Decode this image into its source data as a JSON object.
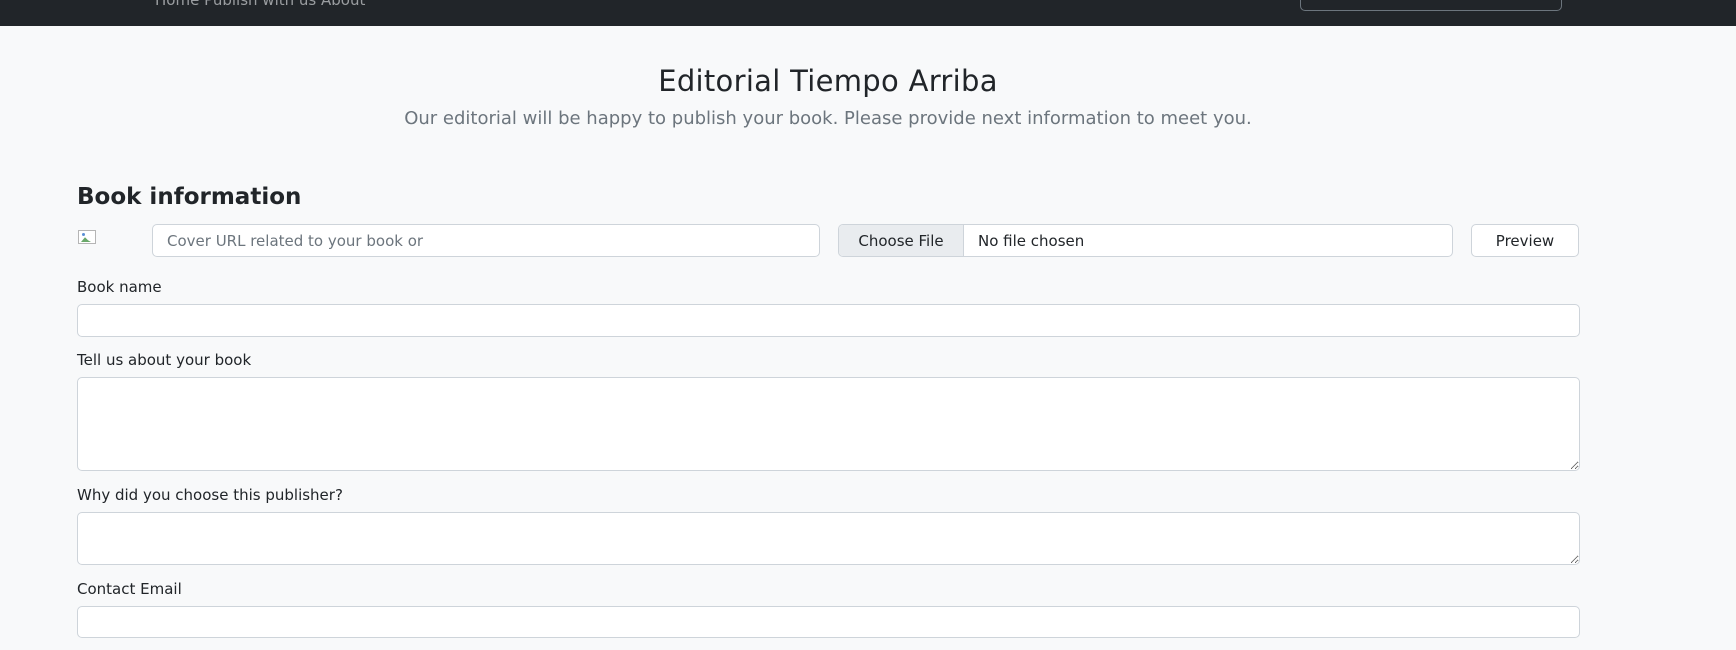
{
  "header": {
    "nav_fragment": "Home   Publish with us   About"
  },
  "hero": {
    "title": "Editorial Tiempo Arriba",
    "subtitle": "Our editorial will be happy to publish your book. Please provide next information to meet you."
  },
  "book_section": {
    "title": "Book information",
    "cover_url_placeholder": "Cover URL related to your book or",
    "file_button_label": "Choose File",
    "file_status": "No file chosen",
    "preview_button_label": "Preview"
  },
  "form": {
    "book_name_label": "Book name",
    "book_name_value": "",
    "about_label": "Tell us about your book",
    "about_value": "",
    "why_label": "Why did you choose this publisher?",
    "why_value": "",
    "email_label": "Contact Email",
    "email_value": ""
  }
}
